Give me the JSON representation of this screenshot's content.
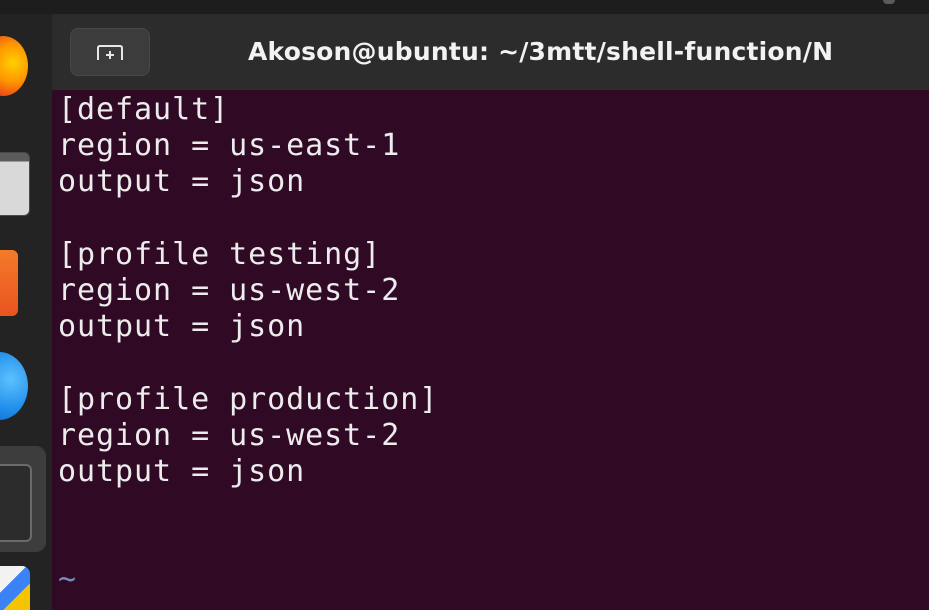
{
  "window": {
    "title": "Akoson@ubuntu: ~/3mtt/shell-function/N"
  },
  "titlebar": {
    "new_tab_icon": "new-tab-icon"
  },
  "dock": {
    "apps": [
      {
        "name": "firefox-icon"
      },
      {
        "name": "files-icon"
      },
      {
        "name": "software-icon"
      },
      {
        "name": "thunderbird-icon"
      },
      {
        "name": "terminal-icon"
      },
      {
        "name": "text-editor-icon"
      }
    ]
  },
  "terminal": {
    "lines": [
      "[default]",
      "region = us-east-1",
      "output = json",
      "",
      "[profile testing]",
      "region = us-west-2",
      "output = json",
      "",
      "[profile production]",
      "region = us-west-2",
      "output = json",
      "",
      "",
      "~",
      "~"
    ]
  },
  "colors": {
    "terminal_background": "#300a24",
    "terminal_text": "#ececec",
    "tilde": "#6f8fb8",
    "titlebar": "#2c2c2c",
    "dock": "#232323"
  }
}
